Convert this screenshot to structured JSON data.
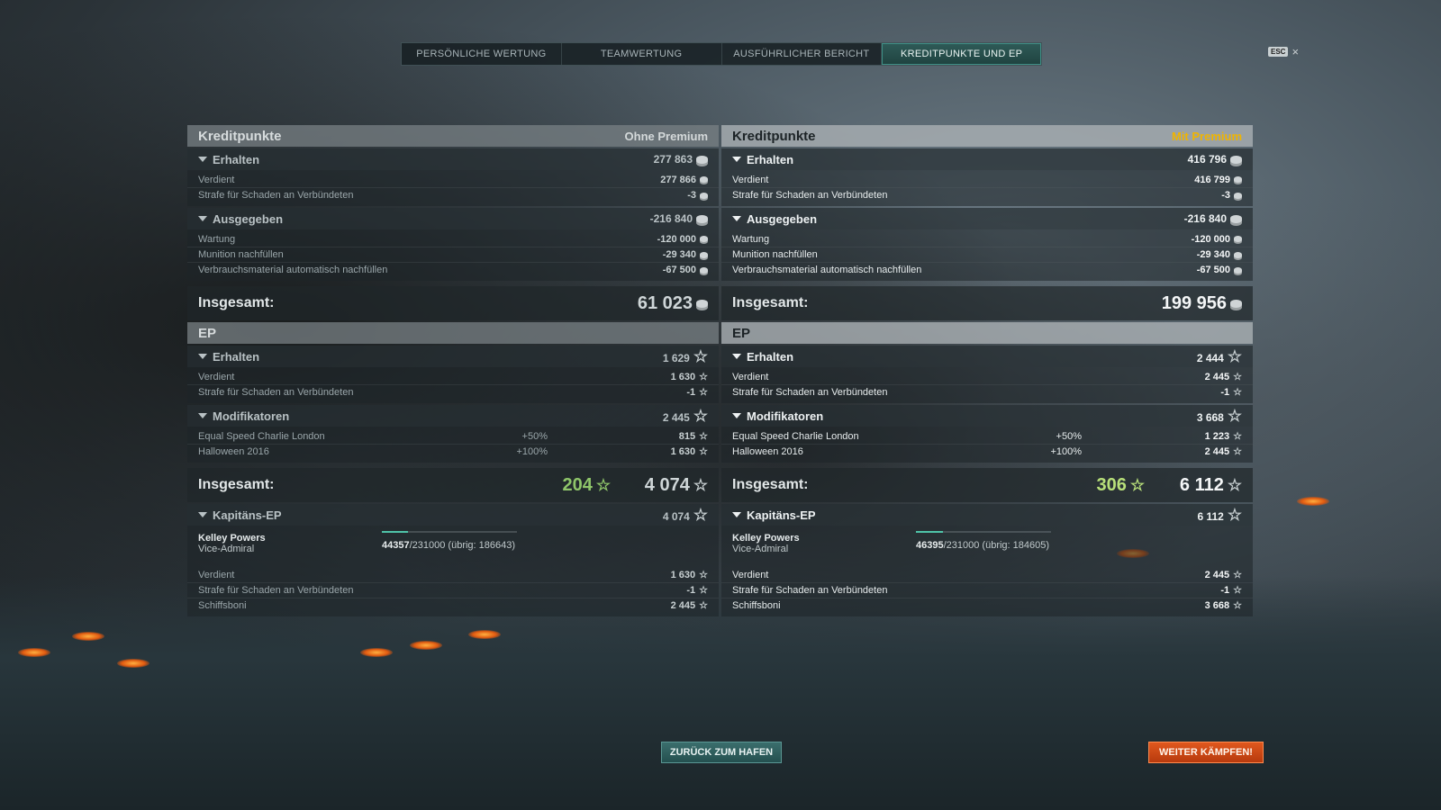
{
  "tabs": [
    "PERSÖNLICHE WERTUNG",
    "TEAMWERTUNG",
    "AUSFÜHRLICHER BERICHT",
    "KREDITPUNKTE UND EP"
  ],
  "esc_label": "ESC",
  "close_glyph": "×",
  "left": {
    "credits_title": "Kreditpunkte",
    "mode": "Ohne Premium",
    "received": {
      "label": "Erhalten",
      "value": "277 863",
      "items": [
        {
          "label": "Verdient",
          "value": "277 866"
        },
        {
          "label": "Strafe für Schaden an Verbündeten",
          "value": "-3"
        }
      ]
    },
    "spent": {
      "label": "Ausgegeben",
      "value": "-216 840",
      "items": [
        {
          "label": "Wartung",
          "value": "-120 000"
        },
        {
          "label": "Munition nachfüllen",
          "value": "-29 340"
        },
        {
          "label": "Verbrauchsmaterial automatisch nachfüllen",
          "value": "-67 500"
        }
      ]
    },
    "credits_total": {
      "label": "Insgesamt:",
      "value": "61 023"
    },
    "ep_title": "EP",
    "ep_received": {
      "label": "Erhalten",
      "value": "1 629",
      "items": [
        {
          "label": "Verdient",
          "value": "1 630"
        },
        {
          "label": "Strafe für Schaden an Verbündeten",
          "value": "-1"
        }
      ]
    },
    "modifiers": {
      "label": "Modifikatoren",
      "value": "2 445",
      "items": [
        {
          "label": "Equal Speed Charlie London",
          "pct": "+50%",
          "value": "815"
        },
        {
          "label": "Halloween 2016",
          "pct": "+100%",
          "value": "1 630"
        }
      ]
    },
    "ep_total": {
      "label": "Insgesamt:",
      "premium_value": "204",
      "value": "4 074"
    },
    "captain_ep": {
      "label": "Kapitäns-EP",
      "value": "4 074"
    },
    "captain": {
      "name": "Kelley Powers",
      "rank": "Vice-Admiral",
      "exp": "44357",
      "exp_max": "/231000",
      "remaining": "(übrig: 186643)",
      "progress": 0.19,
      "items": [
        {
          "label": "Verdient",
          "value": "1 630"
        },
        {
          "label": "Strafe für Schaden an Verbündeten",
          "value": "-1"
        },
        {
          "label": "Schiffsboni",
          "value": "2 445"
        }
      ]
    }
  },
  "right": {
    "credits_title": "Kreditpunkte",
    "mode": "Mit Premium",
    "received": {
      "label": "Erhalten",
      "value": "416 796",
      "items": [
        {
          "label": "Verdient",
          "value": "416 799"
        },
        {
          "label": "Strafe für Schaden an Verbündeten",
          "value": "-3"
        }
      ]
    },
    "spent": {
      "label": "Ausgegeben",
      "value": "-216 840",
      "items": [
        {
          "label": "Wartung",
          "value": "-120 000"
        },
        {
          "label": "Munition nachfüllen",
          "value": "-29 340"
        },
        {
          "label": "Verbrauchsmaterial automatisch nachfüllen",
          "value": "-67 500"
        }
      ]
    },
    "credits_total": {
      "label": "Insgesamt:",
      "value": "199 956"
    },
    "ep_title": "EP",
    "ep_received": {
      "label": "Erhalten",
      "value": "2 444",
      "items": [
        {
          "label": "Verdient",
          "value": "2 445"
        },
        {
          "label": "Strafe für Schaden an Verbündeten",
          "value": "-1"
        }
      ]
    },
    "modifiers": {
      "label": "Modifikatoren",
      "value": "3 668",
      "items": [
        {
          "label": "Equal Speed Charlie London",
          "pct": "+50%",
          "value": "1 223"
        },
        {
          "label": "Halloween 2016",
          "pct": "+100%",
          "value": "2 445"
        }
      ]
    },
    "ep_total": {
      "label": "Insgesamt:",
      "premium_value": "306",
      "value": "6 112"
    },
    "captain_ep": {
      "label": "Kapitäns-EP",
      "value": "6 112"
    },
    "captain": {
      "name": "Kelley Powers",
      "rank": "Vice-Admiral",
      "exp": "46395",
      "exp_max": "/231000",
      "remaining": "(übrig: 184605)",
      "progress": 0.2,
      "items": [
        {
          "label": "Verdient",
          "value": "2 445"
        },
        {
          "label": "Strafe für Schaden an Verbündeten",
          "value": "-1"
        },
        {
          "label": "Schiffsboni",
          "value": "3 668"
        }
      ]
    }
  },
  "buttons": {
    "harbor": "ZURÜCK ZUM HAFEN",
    "fight": "WEITER KÄMPFEN!"
  },
  "colors": {
    "premium": "#f0b400",
    "accent": "#3e8f86",
    "fight": "#e0581e",
    "ep_bonus": "#b8e07a"
  },
  "icons": {
    "credits": "credits-coin-icon",
    "ep": "star-icon",
    "collapse": "triangle-down-icon"
  }
}
